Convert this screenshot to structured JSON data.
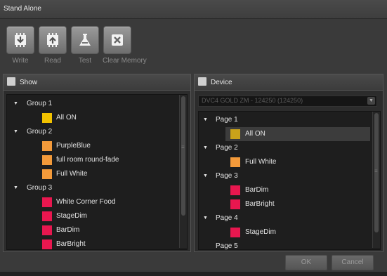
{
  "window": {
    "title": "Stand Alone"
  },
  "toolbar": {
    "write": {
      "label": "Write",
      "icon": "write-chip-icon"
    },
    "read": {
      "label": "Read",
      "icon": "read-chip-icon"
    },
    "test": {
      "label": "Test",
      "icon": "flask-icon"
    },
    "clear": {
      "label": "Clear Memory",
      "icon": "clear-x-icon"
    }
  },
  "show": {
    "title": "Show",
    "icon": "show-icon",
    "groups": [
      {
        "label": "Group 1",
        "items": [
          {
            "label": "All ON",
            "color": "#f2c200"
          }
        ]
      },
      {
        "label": "Group 2",
        "items": [
          {
            "label": "PurpleBlue",
            "color": "#f39a3a"
          },
          {
            "label": "full room round-fade",
            "color": "#f39a3a"
          },
          {
            "label": "Full White",
            "color": "#f39a3a"
          }
        ]
      },
      {
        "label": "Group 3",
        "items": [
          {
            "label": "White Corner Food",
            "color": "#e8174f"
          },
          {
            "label": "StageDim",
            "color": "#e8174f"
          },
          {
            "label": "BarDim",
            "color": "#e8174f"
          },
          {
            "label": "BarBright",
            "color": "#e8174f"
          }
        ]
      }
    ]
  },
  "device": {
    "title": "Device",
    "icon": "device-icon",
    "selected": "DVC4 GOLD ZM - 124250 (124250)",
    "pages": [
      {
        "label": "Page 1",
        "items": [
          {
            "label": "All ON",
            "color": "#c9a21a",
            "selected": true
          }
        ]
      },
      {
        "label": "Page 2",
        "items": [
          {
            "label": "Full White",
            "color": "#f39a3a"
          }
        ]
      },
      {
        "label": "Page 3",
        "items": [
          {
            "label": "BarDim",
            "color": "#e8174f"
          },
          {
            "label": "BarBright",
            "color": "#e8174f"
          }
        ]
      },
      {
        "label": "Page 4",
        "items": [
          {
            "label": "StageDim",
            "color": "#e8174f"
          }
        ]
      },
      {
        "label": "Page 5",
        "items": []
      }
    ]
  },
  "buttons": {
    "ok": "OK",
    "cancel": "Cancel"
  }
}
